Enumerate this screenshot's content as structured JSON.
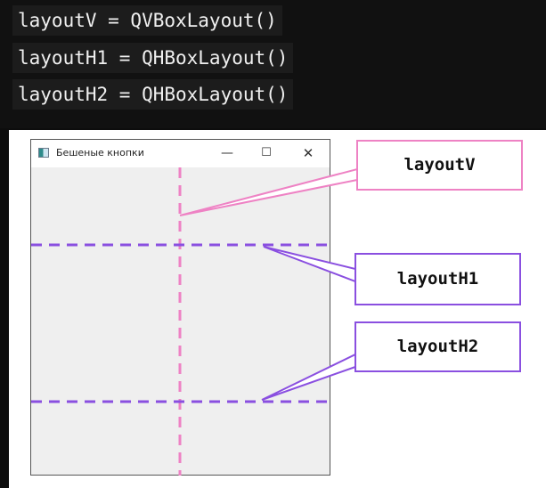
{
  "code": {
    "lines": [
      "layoutV = QVBoxLayout()",
      "layoutH1 = QHBoxLayout()",
      "layoutH2 = QHBoxLayout()"
    ]
  },
  "window": {
    "title": "Бешеные кнопки",
    "minimize_glyph": "—",
    "maximize_glyph": "☐",
    "close_glyph": "✕"
  },
  "callouts": {
    "v": "layoutV",
    "h1": "layoutH1",
    "h2": "layoutH2"
  },
  "colors": {
    "layoutV": "#ee82c4",
    "layoutH": "#8a4fe0",
    "code_background": "#111111",
    "window_background": "#efefef"
  },
  "icons": [
    "app-icon",
    "minimize-icon",
    "maximize-icon",
    "close-icon"
  ]
}
